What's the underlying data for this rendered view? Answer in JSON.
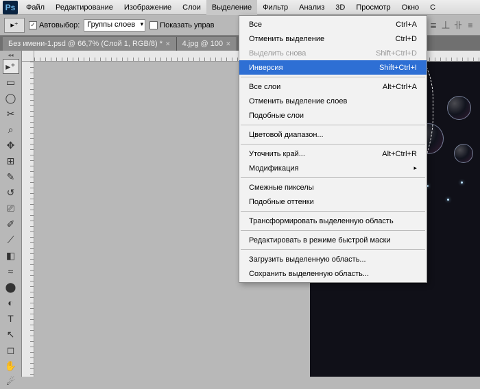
{
  "app_logo_text": "Ps",
  "menu": {
    "items": [
      "Файл",
      "Редактирование",
      "Изображение",
      "Слои",
      "Выделение",
      "Фильтр",
      "Анализ",
      "3D",
      "Просмотр",
      "Окно",
      "С"
    ],
    "active_index": 4
  },
  "options": {
    "tool_arrow_glyph": "▸⁺",
    "auto_select_label": "Автовыбор:",
    "auto_select_checked": true,
    "auto_select_dropdown": "Группы слоев",
    "show_controls_label": "Показать управ",
    "show_controls_checked": false,
    "right_icons": [
      "☰",
      "≣",
      "丄",
      "卝",
      "≡"
    ]
  },
  "tabs": [
    {
      "label": "Без имени-1.psd @ 66,7% (Слой 1, RGB/8) *"
    },
    {
      "label": "4.jpg @ 100"
    }
  ],
  "toolbox_glyphs": [
    "▸⁺",
    "▭",
    "◯",
    "✂",
    "⌕",
    "✥",
    "⊞",
    "✎",
    "↺",
    "⎚",
    "✐",
    "⟋",
    "◧",
    "≈",
    "⬤",
    "◐",
    "T",
    "↖",
    "◻",
    "✋",
    "☄"
  ],
  "dropdown": {
    "sections": [
      [
        {
          "label": "Все",
          "shortcut": "Ctrl+A"
        },
        {
          "label": "Отменить выделение",
          "shortcut": "Ctrl+D"
        },
        {
          "label": "Выделить снова",
          "shortcut": "Shift+Ctrl+D",
          "disabled": true
        },
        {
          "label": "Инверсия",
          "shortcut": "Shift+Ctrl+I",
          "hl": true
        }
      ],
      [
        {
          "label": "Все слои",
          "shortcut": "Alt+Ctrl+A"
        },
        {
          "label": "Отменить выделение слоев"
        },
        {
          "label": "Подобные слои"
        }
      ],
      [
        {
          "label": "Цветовой диапазон..."
        }
      ],
      [
        {
          "label": "Уточнить край...",
          "shortcut": "Alt+Ctrl+R"
        },
        {
          "label": "Модификация",
          "submenu": true
        }
      ],
      [
        {
          "label": "Смежные пикселы"
        },
        {
          "label": "Подобные оттенки"
        }
      ],
      [
        {
          "label": "Трансформировать выделенную область"
        }
      ],
      [
        {
          "label": "Редактировать в режиме быстрой маски"
        }
      ],
      [
        {
          "label": "Загрузить выделенную область..."
        },
        {
          "label": "Сохранить выделенную область..."
        }
      ]
    ]
  }
}
